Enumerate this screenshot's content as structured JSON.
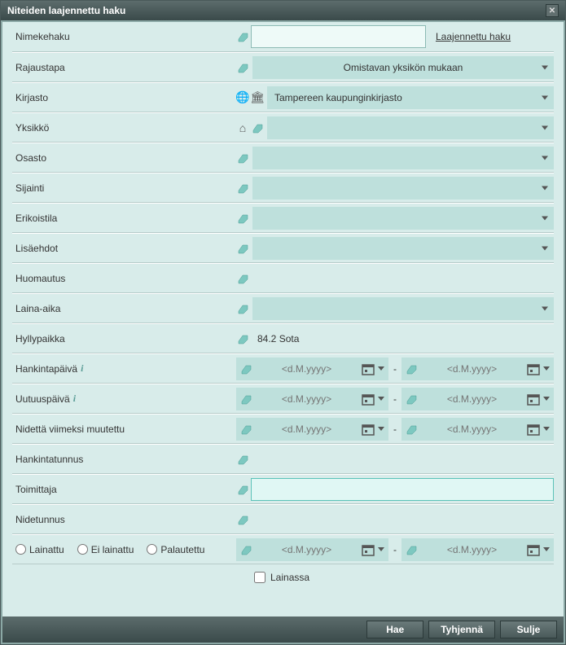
{
  "title": "Niteiden laajennettu haku",
  "labels": {
    "nimekehaku": "Nimekehaku",
    "rajaustapa": "Rajaustapa",
    "kirjasto": "Kirjasto",
    "yksikko": "Yksikkö",
    "osasto": "Osasto",
    "sijainti": "Sijainti",
    "erikoistila": "Erikoistila",
    "lisaehdot": "Lisäehdot",
    "huomautus": "Huomautus",
    "laina_aika": "Laina-aika",
    "hyllypaikka": "Hyllypaikka",
    "hankintapaiva": "Hankintapäivä",
    "uutuuspaiva": "Uutuuspäivä",
    "nidetta_viimeksi": "Nidettä viimeksi muutettu",
    "hankintatunnus": "Hankintatunnus",
    "toimittaja": "Toimittaja",
    "nidetunnus": "Nidetunnus"
  },
  "extended_search": "Laajennettu haku",
  "rajaustapa_value": "Omistavan yksikön mukaan",
  "kirjasto_value": "Tampereen kaupunginkirjasto",
  "hyllypaikka_value": "84.2 Sota",
  "date_placeholder": "<d.M.yyyy>",
  "radios": {
    "lainattu": "Lainattu",
    "ei_lainattu": "Ei lainattu",
    "palautettu": "Palautettu"
  },
  "checkbox_lainassa": "Lainassa",
  "buttons": {
    "hae": "Hae",
    "tyhjenna": "Tyhjennä",
    "sulje": "Sulje"
  }
}
